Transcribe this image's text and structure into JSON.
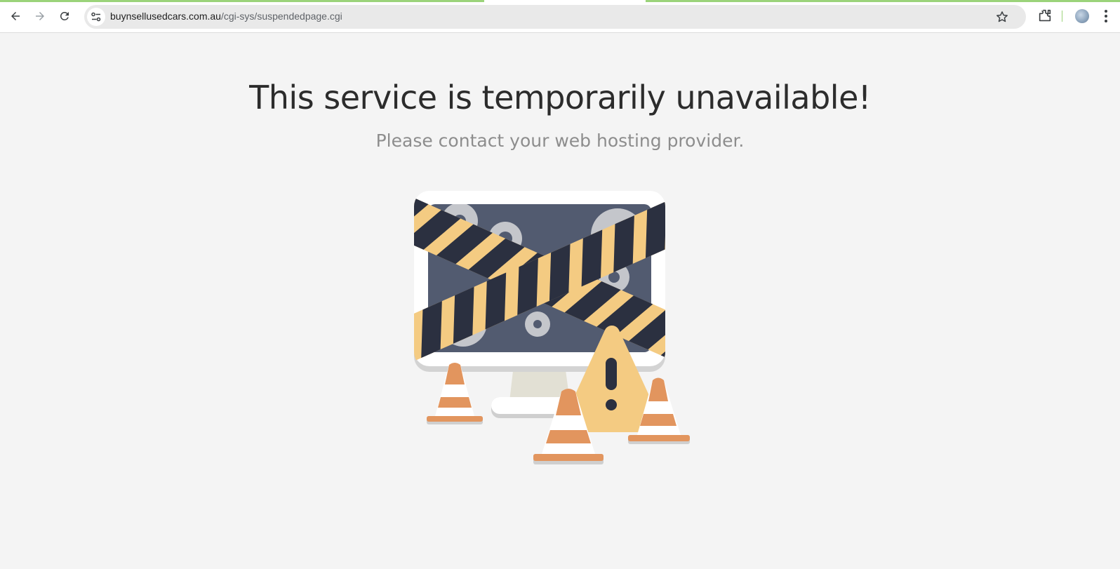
{
  "browser": {
    "url_host": "buynsellusedcars.com.au",
    "url_path": "/cgi-sys/suspendedpage.cgi",
    "icons": [
      "back-icon",
      "forward-icon",
      "reload-icon",
      "site-info-icon",
      "bookmark-star-icon",
      "extensions-icon",
      "profile-avatar",
      "menu-icon"
    ]
  },
  "page": {
    "headline": "This service is temporarily unavailable!",
    "subline": "Please contact your web hosting provider."
  },
  "colors": {
    "background": "#f4f4f4",
    "tape_yellow": "#f4cb82",
    "tape_dark": "#2b3040",
    "screen": "#525b70",
    "cone_orange": "#e2955e"
  }
}
